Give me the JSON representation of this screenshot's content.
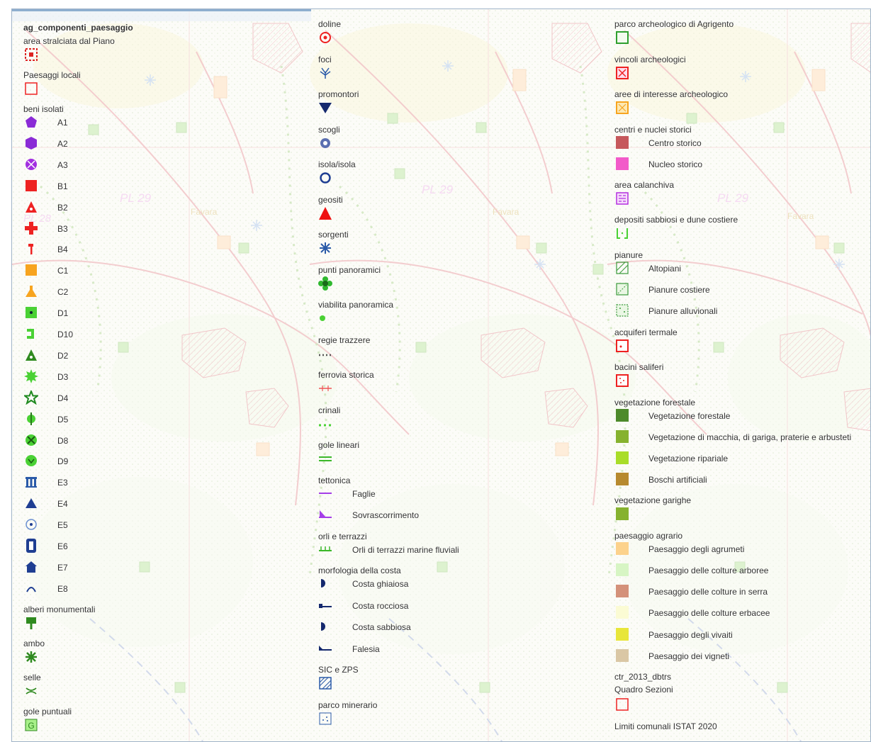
{
  "map": {
    "labels": [
      "PL 29",
      "PL 29",
      "PL 29",
      "Favara",
      "Favara",
      "Favara",
      "PL 28"
    ]
  },
  "col1": {
    "layer_title": "ag_componenti_paesaggio",
    "sections": [
      {
        "title": "area stralciata dal Piano",
        "icon": "red-dotted-square-icon"
      },
      {
        "title": "Paesaggi locali",
        "icon": "red-outline-square-icon"
      },
      {
        "title": "beni isolati",
        "items": [
          {
            "label": "A1",
            "icon": "purple-pentagon-icon"
          },
          {
            "label": "A2",
            "icon": "purple-hexagon-icon"
          },
          {
            "label": "A3",
            "icon": "purple-crossed-circle-icon"
          },
          {
            "label": "B1",
            "icon": "red-square-icon"
          },
          {
            "label": "B2",
            "icon": "red-triangle-icon"
          },
          {
            "label": "B3",
            "icon": "red-cross-icon"
          },
          {
            "label": "B4",
            "icon": "red-hammer-icon"
          },
          {
            "label": "C1",
            "icon": "orange-square-icon"
          },
          {
            "label": "C2",
            "icon": "orange-flask-icon"
          },
          {
            "label": "D1",
            "icon": "green-dot-square-icon"
          },
          {
            "label": "D10",
            "icon": "green-hook-icon"
          },
          {
            "label": "D2",
            "icon": "green-triangle-icon"
          },
          {
            "label": "D3",
            "icon": "green-gear-icon"
          },
          {
            "label": "D4",
            "icon": "green-star-icon"
          },
          {
            "label": "D5",
            "icon": "green-pin-icon"
          },
          {
            "label": "D8",
            "icon": "green-crossed-circle-icon"
          },
          {
            "label": "D9",
            "icon": "green-circle-icon"
          },
          {
            "label": "E3",
            "icon": "blue-columns-icon"
          },
          {
            "label": "E4",
            "icon": "blue-triangle-icon"
          },
          {
            "label": "E5",
            "icon": "blue-target-icon"
          },
          {
            "label": "E6",
            "icon": "blue-tower-icon"
          },
          {
            "label": "E7",
            "icon": "blue-house-icon"
          },
          {
            "label": "E8",
            "icon": "blue-arc-icon"
          }
        ]
      },
      {
        "title": "alberi monumentali",
        "icon": "green-tree-icon"
      },
      {
        "title": "ambo",
        "icon": "green-asterisk-icon"
      },
      {
        "title": "selle",
        "icon": "green-saddle-icon"
      },
      {
        "title": "gole puntuali",
        "icon": "green-g-square-icon"
      }
    ]
  },
  "col2": {
    "sections": [
      {
        "title": "doline",
        "icon": "red-target-icon"
      },
      {
        "title": "foci",
        "icon": "blue-delta-icon"
      },
      {
        "title": "promontori",
        "icon": "navy-triangle-icon"
      },
      {
        "title": "scogli",
        "icon": "blue-rock-icon"
      },
      {
        "title": "isola/isola",
        "icon": "blue-ring-icon"
      },
      {
        "title": "geositi",
        "icon": "red-filled-triangle-icon"
      },
      {
        "title": "sorgenti",
        "icon": "blue-spring-icon"
      },
      {
        "title": "punti panoramici",
        "icon": "green-flower-icon"
      },
      {
        "title": "viabilita panoramica",
        "icon": "green-dot-icon"
      },
      {
        "title": "regie trazzere",
        "icon": "gray-dotted-line-icon"
      },
      {
        "title": "ferrovia storica",
        "icon": "red-rail-icon"
      },
      {
        "title": "crinali",
        "icon": "green-dotted-line-icon"
      },
      {
        "title": "gole lineari",
        "icon": "green-double-line-icon"
      },
      {
        "title": "tettonica",
        "items": [
          {
            "label": "Faglie",
            "icon": "purple-line-icon"
          },
          {
            "label": "Sovrascorrimento",
            "icon": "purple-thrust-icon"
          }
        ]
      },
      {
        "title": "orli e terrazzi",
        "items": [
          {
            "label": "Orli di terrazzi marine fluviali",
            "icon": "green-ticked-line-icon"
          }
        ]
      },
      {
        "title": "morfologia della costa",
        "items": [
          {
            "label": "Costa ghiaiosa",
            "icon": "navy-half-circle-icon"
          },
          {
            "label": "Costa rocciosa",
            "icon": "navy-step-line-icon"
          },
          {
            "label": "Costa sabbiosa",
            "icon": "navy-half-circle-icon"
          },
          {
            "label": "Falesia",
            "icon": "navy-cliff-line-icon"
          }
        ]
      },
      {
        "title": "SIC e ZPS",
        "icon": "blue-hatched-square-icon"
      },
      {
        "title": "parco minerario",
        "icon": "blue-dotted-square-icon"
      }
    ]
  },
  "col3": {
    "sections": [
      {
        "title": "parco archeologico di Agrigento",
        "icon": "green-outline-square-icon"
      },
      {
        "title": "vincoli archeologici",
        "icon": "red-x-square-icon"
      },
      {
        "title": "aree di interesse archeologico",
        "icon": "orange-x-square-icon"
      },
      {
        "title": "centri e nuclei storici",
        "items": [
          {
            "label": "Centro storico",
            "color": "#c6585c"
          },
          {
            "label": "Nucleo storico",
            "color": "#f25ac9"
          }
        ]
      },
      {
        "title": "area calanchiva",
        "icon": "purple-patterned-square-icon"
      },
      {
        "title": "depositi sabbiosi e dune costiere",
        "icon": "green-bracket-square-icon"
      },
      {
        "title": "pianure",
        "items": [
          {
            "label": "Altopiani",
            "icon": "green-hatched-square-icon"
          },
          {
            "label": "Pianure costiere",
            "icon": "green-dotted-square-icon"
          },
          {
            "label": "Pianure alluvionali",
            "icon": "green-stippled-square-icon"
          }
        ]
      },
      {
        "title": "acquiferi termale",
        "icon": "red-dot-square-icon"
      },
      {
        "title": "bacini saliferi",
        "icon": "red-dots-square-icon"
      },
      {
        "title": "vegetazione forestale",
        "items": [
          {
            "label": "Vegetazione forestale",
            "color": "#4d8a2b"
          },
          {
            "label": "Vegetazione di macchia, di gariga, praterie e arbusteti",
            "color": "#86b22f"
          },
          {
            "label": "Vegetazione ripariale",
            "color": "#a9dd29"
          },
          {
            "label": "Boschi artificiali",
            "color": "#b78a2f"
          }
        ]
      },
      {
        "title": "vegetazione garighe",
        "color": "#86b22f"
      },
      {
        "title": "paesaggio agrario",
        "items": [
          {
            "label": "Paesaggio degli agrumeti",
            "color": "#fcd28c"
          },
          {
            "label": "Paesaggio delle colture arboree",
            "color": "#d7f5c4"
          },
          {
            "label": "Paesaggio delle colture in serra",
            "color": "#d4917a"
          },
          {
            "label": "Paesaggio delle colture erbacee",
            "color": "#fbfbd4"
          },
          {
            "label": "Paesaggio degli vivaiti",
            "color": "#e8e63a"
          },
          {
            "label": "Paesaggio dei vigneti",
            "color": "#dac7a5"
          }
        ]
      },
      {
        "title": "ctr_2013_dbtrs",
        "subtitle": "Quadro Sezioni",
        "icon": "red-outline-square-icon"
      },
      {
        "title": "Limiti comunali ISTAT 2020"
      }
    ]
  }
}
